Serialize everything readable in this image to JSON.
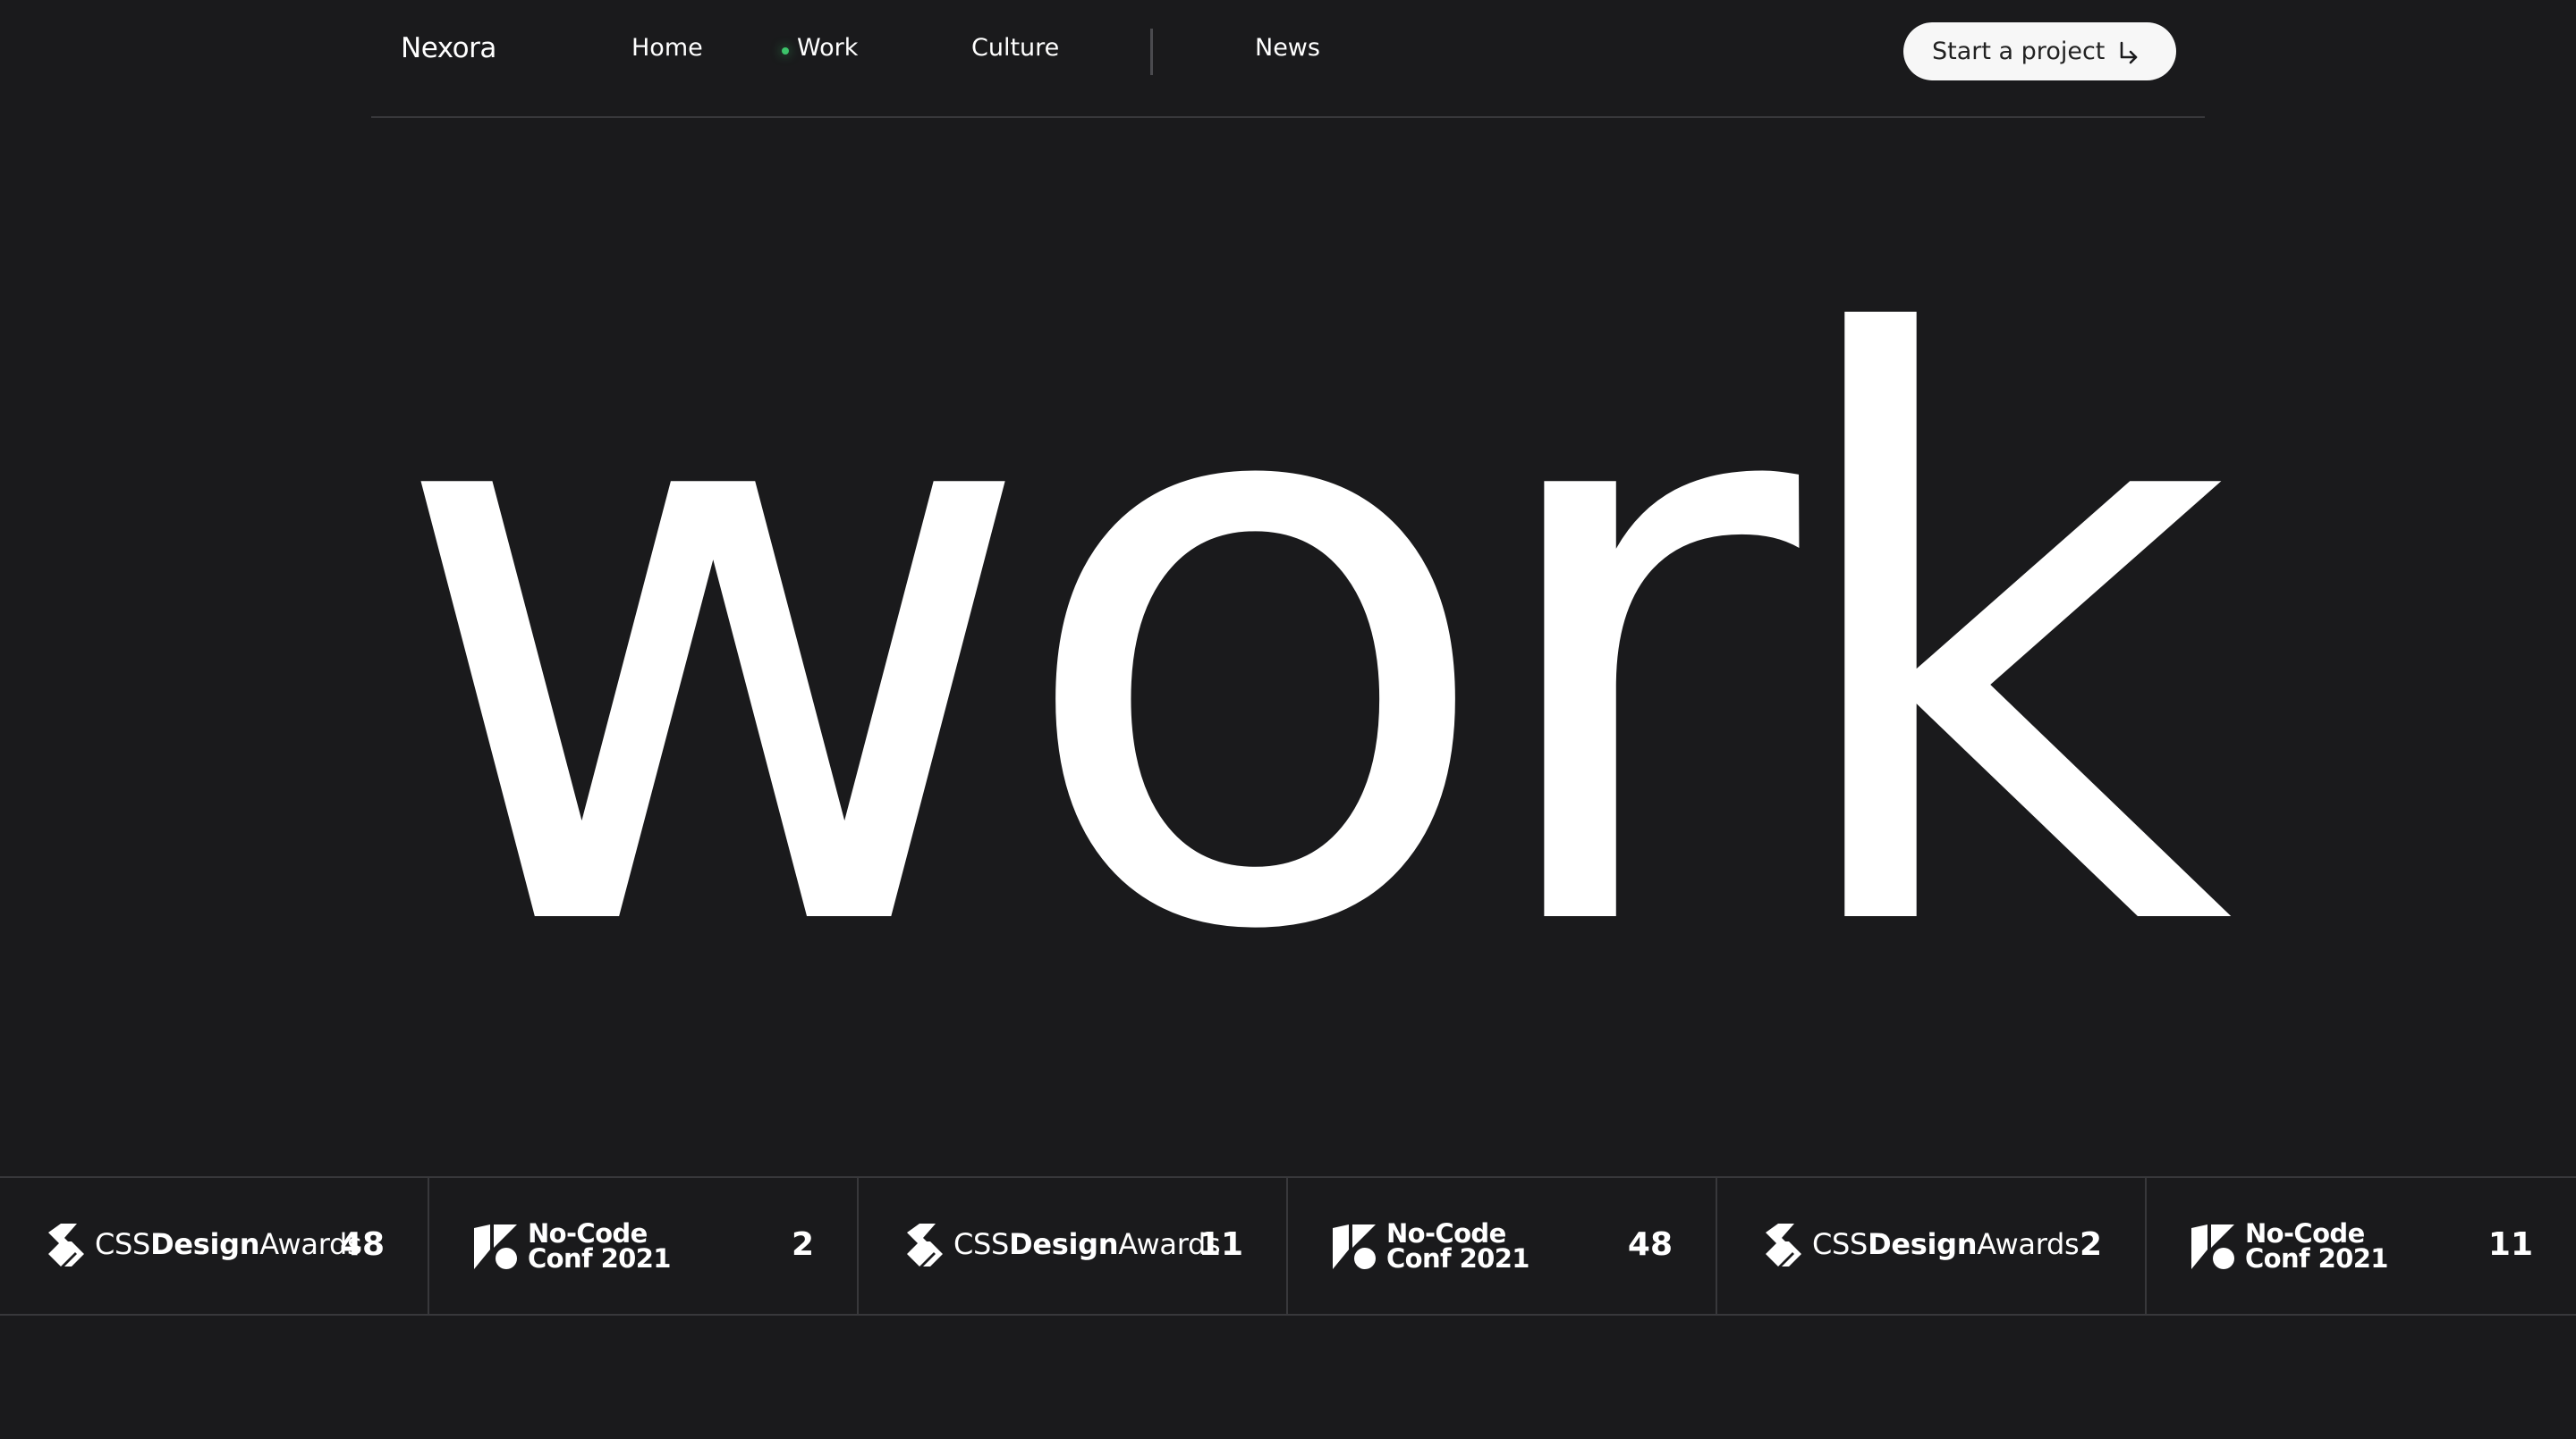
{
  "brand": {
    "name": "Nexora"
  },
  "nav": {
    "items": [
      {
        "label": "Home",
        "active": false
      },
      {
        "label": "Work",
        "active": true
      },
      {
        "label": "Culture",
        "active": false
      },
      {
        "label": "News",
        "active": false
      }
    ],
    "active_indicator_color": "#3cc46a"
  },
  "cta": {
    "label": "Start a project",
    "icon": "arrow-down-right-icon"
  },
  "hero": {
    "title": "work"
  },
  "awards": [
    {
      "type": "cssdesignawards",
      "prefix": "CSS",
      "bold": "Design",
      "suffix": "Awards",
      "count": "48",
      "icon": "cssda-icon"
    },
    {
      "type": "nocode",
      "line1": "No-Code",
      "line2": "Conf 2021",
      "count": "2",
      "icon": "nocode-icon"
    },
    {
      "type": "cssdesignawards",
      "prefix": "CSS",
      "bold": "Design",
      "suffix": "Awards",
      "count": "11",
      "icon": "cssda-icon"
    },
    {
      "type": "nocode",
      "line1": "No-Code",
      "line2": "Conf 2021",
      "count": "48",
      "icon": "nocode-icon"
    },
    {
      "type": "cssdesignawards",
      "prefix": "CSS",
      "bold": "Design",
      "suffix": "Awards",
      "count": "2",
      "icon": "cssda-icon"
    },
    {
      "type": "nocode",
      "line1": "No-Code",
      "line2": "Conf 2021",
      "count": "11",
      "icon": "nocode-icon"
    }
  ],
  "colors": {
    "background": "#1a1a1c",
    "text": "#ffffff",
    "cta_bg": "#f7f7f7",
    "divider": "#38383b"
  }
}
